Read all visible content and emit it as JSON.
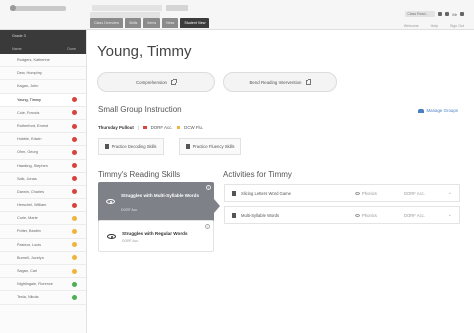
{
  "header": {
    "top_tabs": [
      "Class Overview",
      "Skills",
      "Items",
      "Ness",
      "Student View"
    ],
    "active_tab_index": 4,
    "user_select": "Class Read...",
    "user_name": "Mr",
    "user_links": [
      "Welcome",
      "Help",
      "Sign Out"
    ]
  },
  "sidebar": {
    "title": "Grade 3",
    "col_name": "Name",
    "col_status": "Done",
    "students": [
      {
        "name": "Rodgers, Katherine",
        "status": null
      },
      {
        "name": "Dew, Humphry",
        "status": null
      },
      {
        "name": "Kagan, John",
        "status": null
      },
      {
        "name": "Young, Timmy",
        "status": "#d9433b",
        "selected": true
      },
      {
        "name": "Cole, Francis",
        "status": "#d9433b"
      },
      {
        "name": "Rutherford, Ernest",
        "status": "#d9433b"
      },
      {
        "name": "Hubble, Edwin",
        "status": "#d9433b"
      },
      {
        "name": "Ohm, Georg",
        "status": "#d9433b"
      },
      {
        "name": "Hawking, Stephen",
        "status": "#d9433b"
      },
      {
        "name": "Salk, Jonas",
        "status": "#d9433b"
      },
      {
        "name": "Darwin, Charles",
        "status": "#d9433b"
      },
      {
        "name": "Herschel, William",
        "status": "#d9433b"
      },
      {
        "name": "Curie, Marie",
        "status": "#f0b43c"
      },
      {
        "name": "Potter, Beatrix",
        "status": "#f0b43c"
      },
      {
        "name": "Pasteur, Louis",
        "status": "#f0b43c"
      },
      {
        "name": "Burnell, Jocelyn",
        "status": "#f0b43c"
      },
      {
        "name": "Sagan, Carl",
        "status": "#f0b43c"
      },
      {
        "name": "Nightingale, Florence",
        "status": "#4caf50"
      },
      {
        "name": "Tesla, Nikola",
        "status": "#4caf50"
      }
    ]
  },
  "main": {
    "student_name": "Young, Timmy",
    "comprehension_label": "Comprehension",
    "intervention_label": "Bend Reading Intervention",
    "small_group_title": "Small Group Instruction",
    "manage_groups_label": "Manage Groups",
    "group_day": "Thursday Pullout",
    "group_tag1": "DORF Acc.",
    "group_tag1_color": "#d9433b",
    "group_tag2": "DCW Flu.",
    "group_tag2_color": "#f0b43c",
    "practice_decoding_label": "Practice Decoding Skills",
    "practice_fluency_label": "Practice Fluency Skills",
    "reading_skills_title": "Timmy's Reading Skills",
    "skill_cards": [
      {
        "title": "Struggles with Multi-Syllable Words",
        "subtitle": "DORF Acc."
      },
      {
        "title": "Struggles with Regular Words",
        "subtitle": "DORF Acc."
      }
    ],
    "activities_title": "Activities for Timmy",
    "activities": [
      {
        "name": "Slicing Letters Word Game",
        "meta": "Phonics",
        "group": "DORF Acc."
      },
      {
        "name": "Multi-Syllable Words",
        "meta": "Phonics",
        "group": "DORF Acc."
      }
    ]
  },
  "colors": {
    "red": "#d9433b",
    "yellow": "#f0b43c",
    "green": "#4caf50",
    "link": "#4a7fc1",
    "active_card": "#7f8189"
  }
}
